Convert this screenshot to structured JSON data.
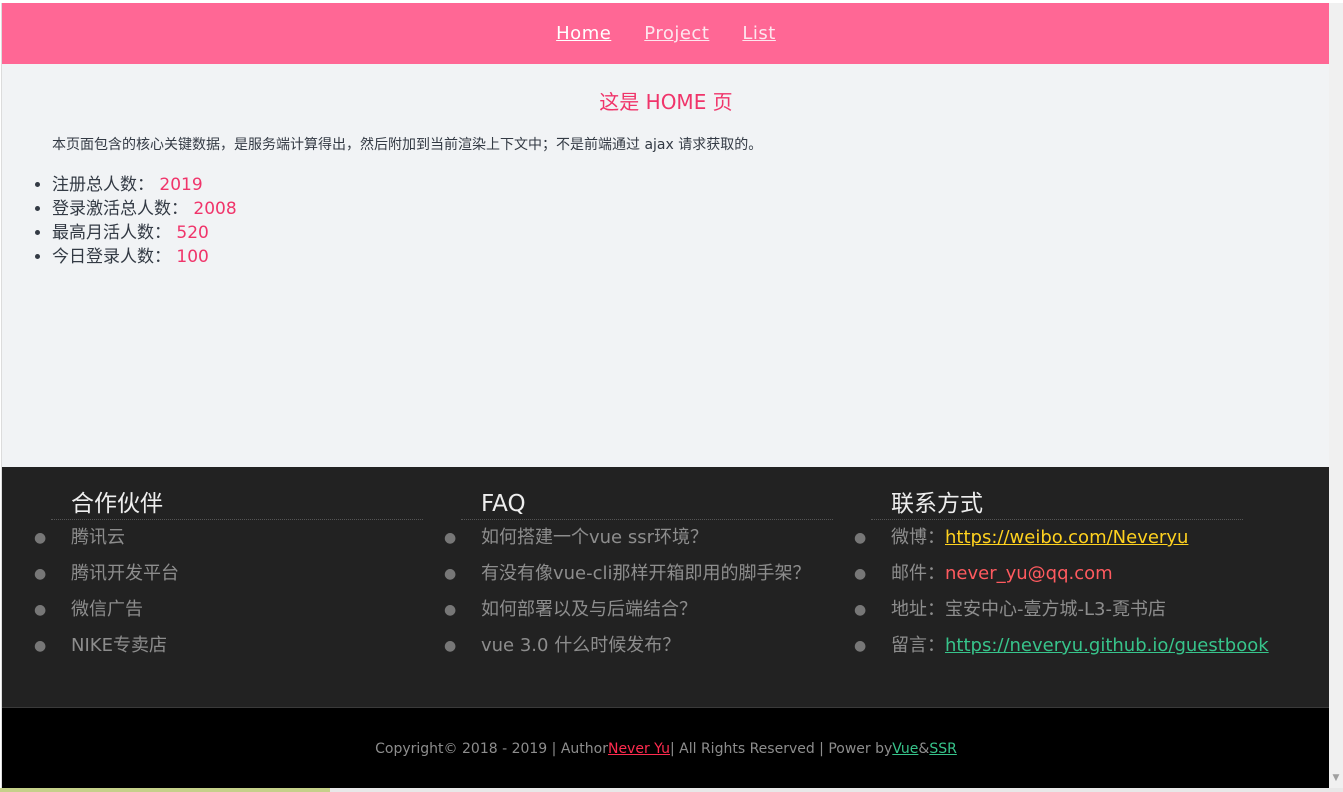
{
  "nav": {
    "items": [
      {
        "label": "Home",
        "active": true
      },
      {
        "label": "Project",
        "active": false
      },
      {
        "label": "List",
        "active": false
      }
    ]
  },
  "home": {
    "title": "这是 HOME 页",
    "description": "本页面包含的核心关键数据，是服务端计算得出，然后附加到当前渲染上下文中；不是前端通过 ajax 请求获取的。",
    "stats": [
      {
        "label": "注册总人数：",
        "value": "2019"
      },
      {
        "label": "登录激活总人数：",
        "value": "2008"
      },
      {
        "label": "最高月活人数：",
        "value": "520"
      },
      {
        "label": "今日登录人数：",
        "value": "100"
      }
    ]
  },
  "footer": {
    "partners": {
      "title": "合作伙伴",
      "items": [
        "腾讯云",
        "腾讯开发平台",
        "微信广告",
        "NIKE专卖店"
      ]
    },
    "faq": {
      "title": "FAQ",
      "items": [
        "如何搭建一个vue ssr环境？",
        "有没有像vue-cli那样开箱即用的脚手架？",
        "如何部署以及与后端结合？",
        "vue 3.0 什么时候发布？"
      ]
    },
    "contact": {
      "title": "联系方式",
      "weibo_label": "微博：",
      "weibo_value": "https://weibo.com/Neveryu",
      "email_label": "邮件：",
      "email_value": "never_yu@qq.com",
      "address_label": "地址：",
      "address_value": "宝安中心-壹方城-L3-覔书店",
      "guestbook_label": "留言：",
      "guestbook_value": "https://neveryu.github.io/guestbook"
    }
  },
  "copyright": {
    "prefix": "Copyright© 2018 - 2019 | Author ",
    "author": "Never Yu",
    "middle": " | All Rights Reserved | Power by ",
    "tech1": "Vue",
    "amp": " & ",
    "tech2": "SSR"
  },
  "colors": {
    "nav_bg": "#ff6795",
    "accent": "#f0346a",
    "footer_bg": "#222222"
  }
}
